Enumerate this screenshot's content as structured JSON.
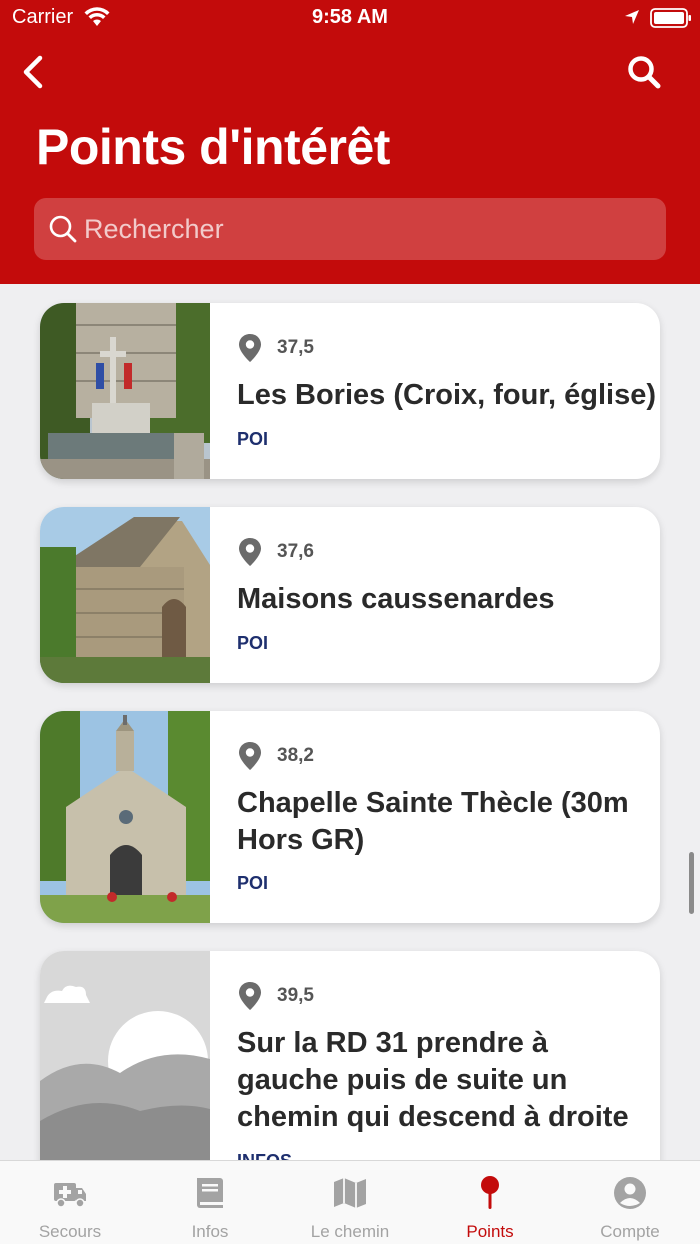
{
  "status": {
    "carrier": "Carrier",
    "time": "9:58 AM"
  },
  "header": {
    "title": "Points d'intérêt"
  },
  "search": {
    "placeholder": "Rechercher"
  },
  "colors": {
    "brand": "#c30b0b",
    "category": "#1e2f6e"
  },
  "pois": [
    {
      "km": "37,5",
      "title": "Les Bories (Croix, four, église)",
      "category": "POI"
    },
    {
      "km": "37,6",
      "title": "Maisons caussenardes",
      "category": "POI"
    },
    {
      "km": "38,2",
      "title": "Chapelle Sainte Thècle (30m Hors GR)",
      "category": "POI"
    },
    {
      "km": "39,5",
      "title": "Sur la RD 31 prendre à gauche puis de suite un chemin qui descend à droite",
      "category": "INFOS"
    }
  ],
  "tabs": [
    {
      "label": "Secours",
      "icon": "ambulance-icon",
      "active": false
    },
    {
      "label": "Infos",
      "icon": "book-icon",
      "active": false
    },
    {
      "label": "Le chemin",
      "icon": "map-icon",
      "active": false
    },
    {
      "label": "Points",
      "icon": "pin-icon",
      "active": true
    },
    {
      "label": "Compte",
      "icon": "account-icon",
      "active": false
    }
  ]
}
